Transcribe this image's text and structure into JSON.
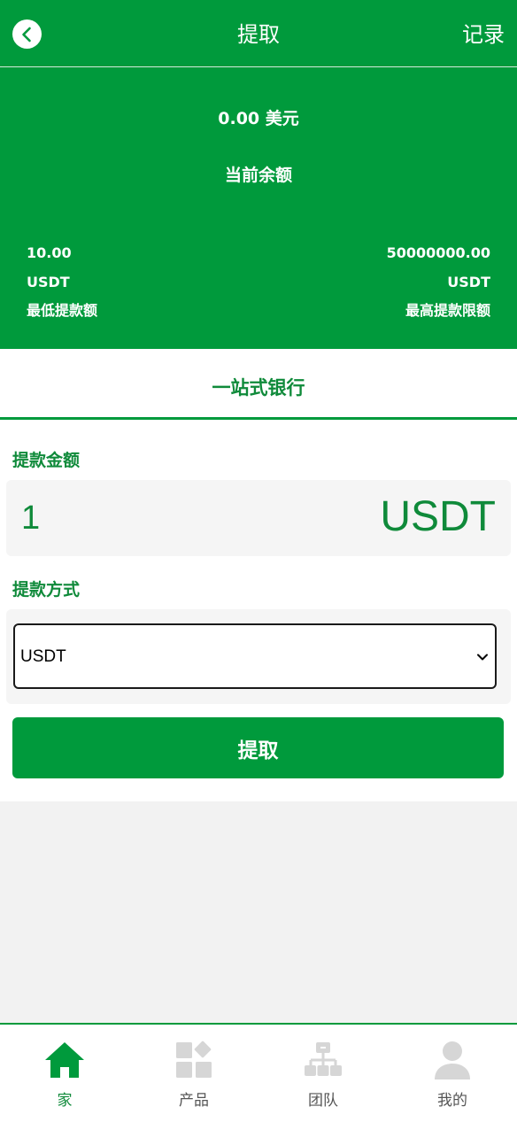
{
  "header": {
    "title": "提取",
    "right_link": "记录"
  },
  "balance": {
    "amount": "0.00 美元",
    "label": "当前余额",
    "min": {
      "value": "10.00",
      "unit": "USDT",
      "label": "最低提款额"
    },
    "max": {
      "value": "50000000.00",
      "unit": "USDT",
      "label": "最高提款限额"
    }
  },
  "tab": {
    "label": "一站式银行"
  },
  "form": {
    "amount_label": "提款金额",
    "amount_value": "1",
    "amount_unit": "USDT",
    "method_label": "提款方式",
    "method_selected": "USDT",
    "submit_label": "提取"
  },
  "nav": {
    "items": [
      {
        "label": "家",
        "icon": "home-icon",
        "active": true
      },
      {
        "label": "产品",
        "icon": "products-icon",
        "active": false
      },
      {
        "label": "团队",
        "icon": "team-icon",
        "active": false
      },
      {
        "label": "我的",
        "icon": "user-icon",
        "active": false
      }
    ]
  },
  "colors": {
    "brand": "#009a3c",
    "brand_text": "#0f8a3a",
    "inactive_icon": "#d6d6d6"
  }
}
